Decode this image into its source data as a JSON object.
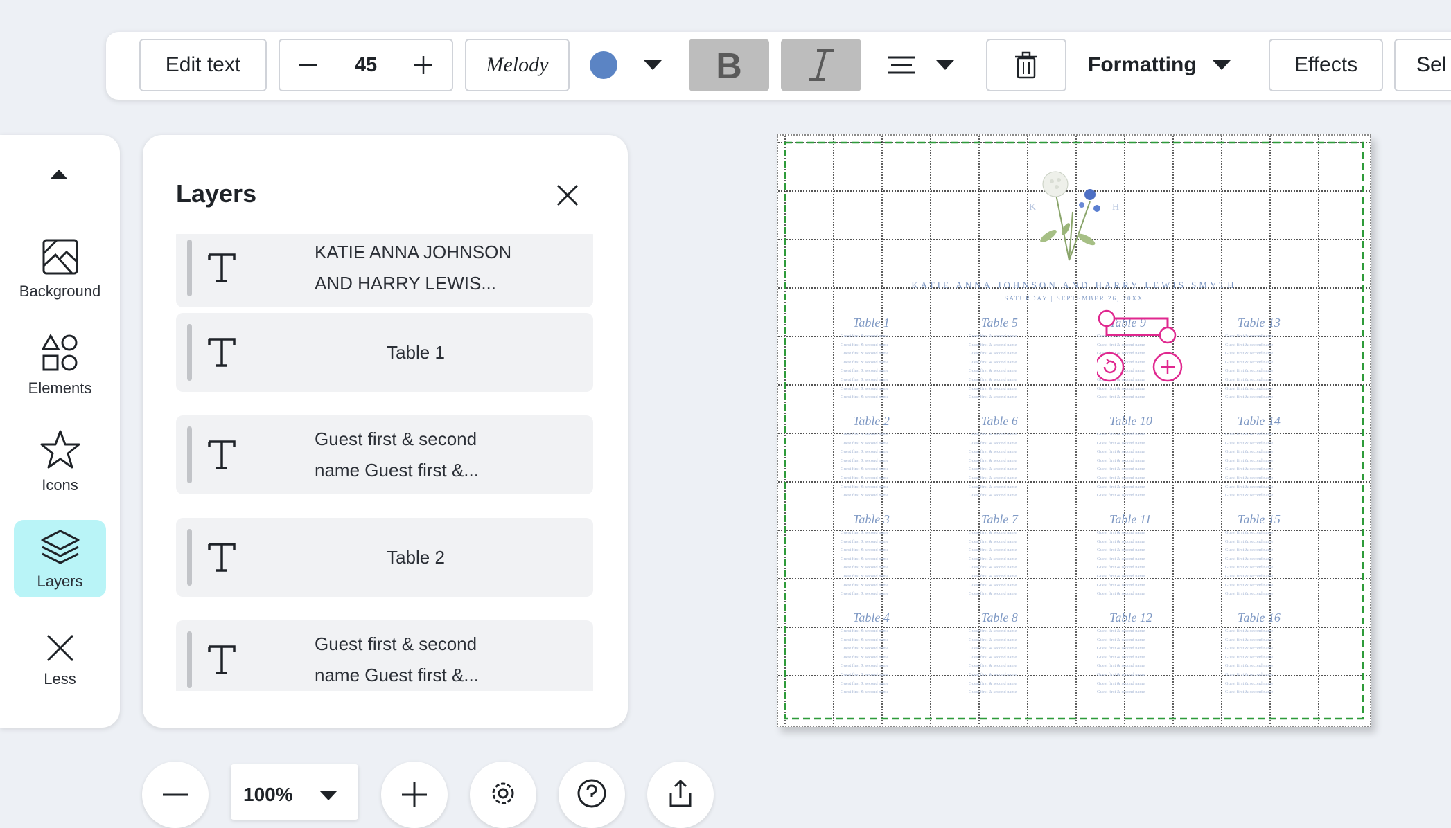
{
  "toolbar": {
    "edit_text": "Edit text",
    "font_size": "45",
    "font_name": "Melody",
    "text_color": "#5b84c4",
    "formatting": "Formatting",
    "effects": "Effects",
    "select_partial": "Sel"
  },
  "sidebar": {
    "items": [
      {
        "label": "Background",
        "icon": "image-icon"
      },
      {
        "label": "Elements",
        "icon": "shapes-icon"
      },
      {
        "label": "Icons",
        "icon": "star-icon"
      },
      {
        "label": "Layers",
        "icon": "layers-icon"
      },
      {
        "label": "Less",
        "icon": "close-icon"
      }
    ]
  },
  "layers_panel": {
    "title": "Layers",
    "items": [
      {
        "text": "KATIE ANNA JOHNSON\nAND HARRY LEWIS..."
      },
      {
        "text": "Table 1"
      },
      {
        "text": "Guest first & second\nname Guest first &..."
      },
      {
        "text": "Table 2"
      },
      {
        "text": "Guest first & second\nname Guest first &..."
      }
    ]
  },
  "bottom": {
    "zoom": "100%"
  },
  "canvas": {
    "names": "KATIE ANNA JOHNSON AND HARRY LEWIS SMYTH",
    "date": "SATURDAY | SEPTEMBER 26, 20XX",
    "monogram_left": "K",
    "monogram_right": "H",
    "guest_line": "Guest first & second name",
    "tables": [
      [
        "Table 1",
        "Table 5",
        "Table 9",
        "Table 13"
      ],
      [
        "Table 2",
        "Table 6",
        "Table 10",
        "Table 14"
      ],
      [
        "Table 3",
        "Table 7",
        "Table 11",
        "Table 15"
      ],
      [
        "Table 4",
        "Table 8",
        "Table 12",
        "Table 16"
      ]
    ],
    "accent_color": "#7f99c4",
    "selection_color": "#e0288f"
  }
}
